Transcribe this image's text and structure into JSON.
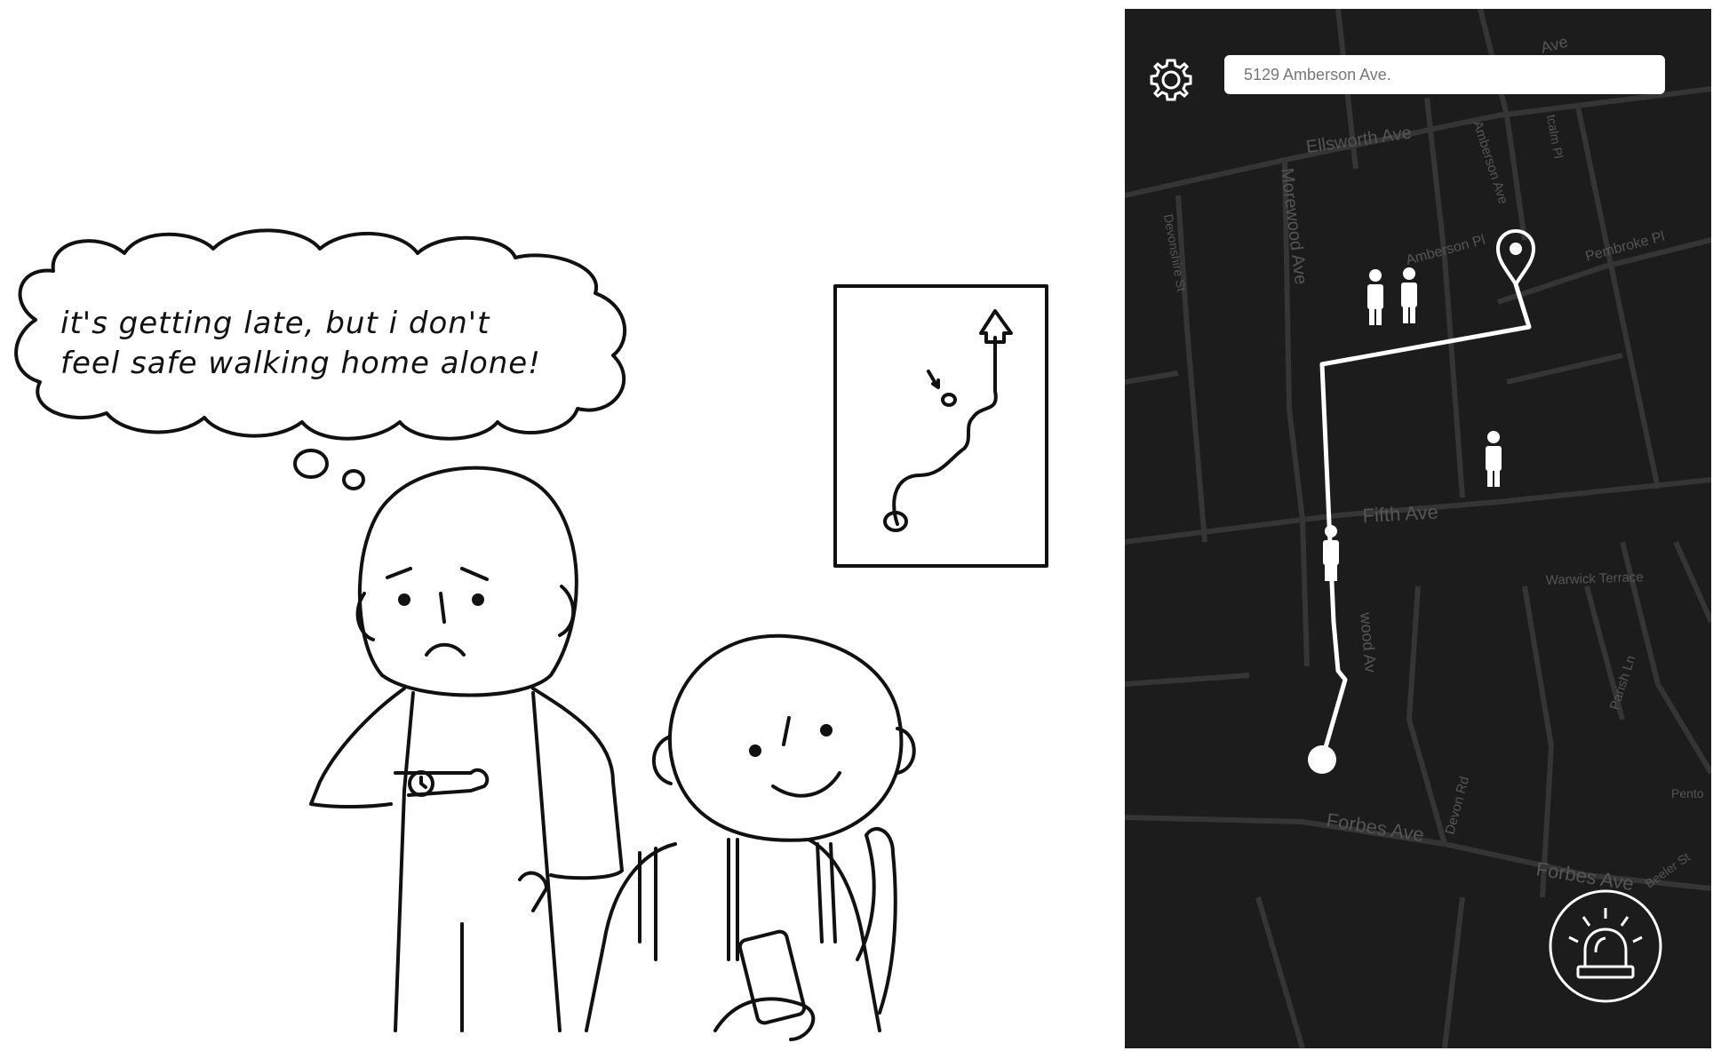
{
  "comic": {
    "thought_line_1": "it's getting late, but i don't",
    "thought_line_2": "feel safe walking home alone!"
  },
  "app": {
    "search": {
      "value": "5129 Amberson Ave."
    },
    "icons": {
      "settings": "gear-icon",
      "alert": "siren-icon",
      "destination": "map-pin-icon",
      "people": "person-icon",
      "origin": "origin-dot"
    },
    "colors": {
      "map_bg": "#1c1c1c",
      "roads": "#3a3a3a",
      "route": "#ffffff",
      "labels": "#555555"
    },
    "streets": {
      "ellsworth": "Ellsworth Ave",
      "morewood": "Morewood Ave",
      "amberson_ave": "Amberson Ave",
      "amberson_pl": "Amberson Pl",
      "pembroke": "Pembroke Pl",
      "devonshire": "Devonshire St",
      "fifth": "Fifth Ave",
      "warwick": "Warwick Terrace",
      "parish": "Parish Ln",
      "devon": "Devon Rd",
      "forbes_1": "Forbes Ave",
      "forbes_2": "Forbes Ave",
      "beeler": "Beeler St",
      "pento": "Pento",
      "morewood_lower": "wood Av",
      "tcalm": "tcalm Pl",
      "top_ave": "Ave"
    }
  }
}
